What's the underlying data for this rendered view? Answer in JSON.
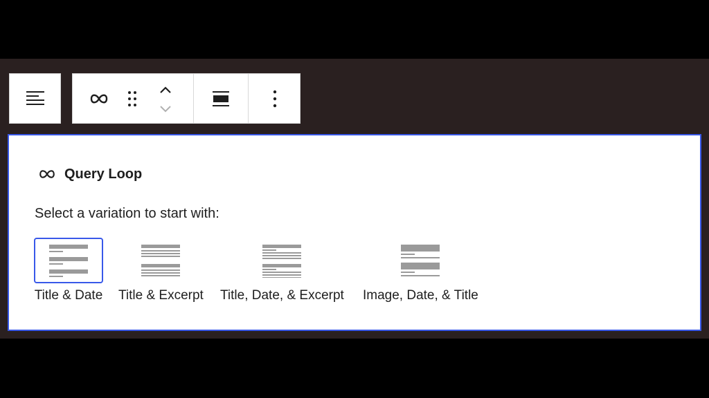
{
  "toolbar": {
    "parent_icon": "align-left-lines-icon",
    "block_icon": "loop-icon",
    "drag_icon": "drag-handle-icon",
    "move_up_icon": "chevron-up-icon",
    "move_down_icon": "chevron-down-icon",
    "align_icon": "align-wide-icon",
    "options_icon": "more-vertical-icon"
  },
  "block": {
    "title": "Query Loop",
    "icon": "loop-icon",
    "instructions": "Select a variation to start with:"
  },
  "variations": [
    {
      "label": "Title & Date",
      "selected": true,
      "icon": "title-date-pattern-icon"
    },
    {
      "label": "Title & Excerpt",
      "selected": false,
      "icon": "title-excerpt-pattern-icon"
    },
    {
      "label": "Title, Date, & Excerpt",
      "selected": false,
      "icon": "title-date-excerpt-pattern-icon"
    },
    {
      "label": "Image, Date, & Title",
      "selected": false,
      "icon": "image-date-title-pattern-icon"
    }
  ],
  "colors": {
    "accent": "#3858e9",
    "backdrop": "#2a2020",
    "letterbox": "#000000",
    "text": "#1e1e1e",
    "pattern_gray": "#9a9a9a"
  }
}
